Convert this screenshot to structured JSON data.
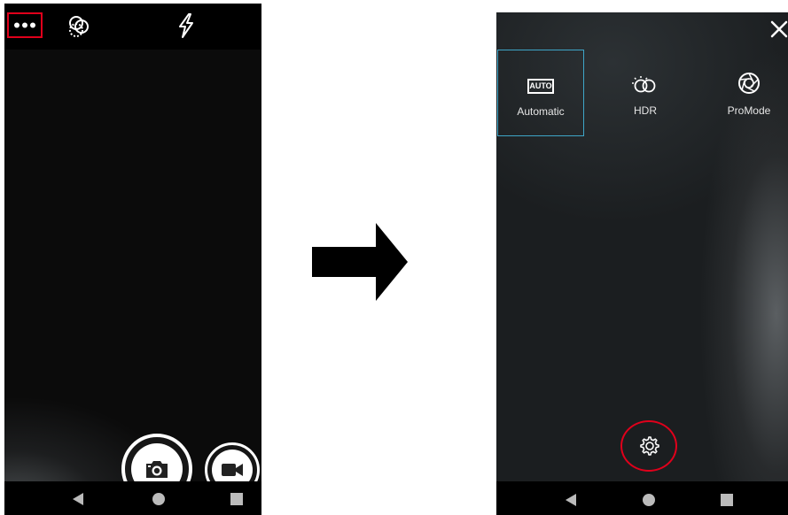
{
  "left_screen": {
    "topbar": {
      "more_icon": "more-horizontal-icon",
      "filter_icon": "filter-circles-icon",
      "flash_icon": "flash-auto-icon"
    },
    "shutter_icon": "camera-icon",
    "video_icon": "video-camera-icon",
    "nav": [
      "back-icon",
      "home-icon",
      "recents-icon"
    ]
  },
  "right_screen": {
    "close_icon": "close-icon",
    "modes": [
      {
        "label": "Automatic",
        "icon_text": "AUTO",
        "selected": true
      },
      {
        "label": "HDR"
      },
      {
        "label": "ProMode"
      }
    ],
    "settings_icon": "settings-gear-icon",
    "nav": [
      "back-icon",
      "home-icon",
      "recents-icon"
    ]
  },
  "colors": {
    "highlight_red": "#e0001b",
    "selection_blue": "#3ea6c8"
  }
}
